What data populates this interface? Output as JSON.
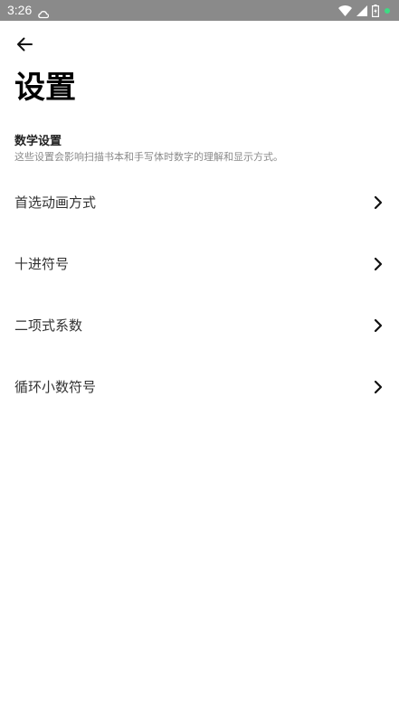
{
  "status_bar": {
    "time": "3:26"
  },
  "header": {
    "title": "设置"
  },
  "section": {
    "title": "数学设置",
    "description": "这些设置会影响扫描书本和手写体时数字的理解和显示方式。"
  },
  "settings": [
    {
      "label": "首选动画方式"
    },
    {
      "label": "十进符号"
    },
    {
      "label": "二项式系数"
    },
    {
      "label": "循环小数符号"
    }
  ],
  "colors": {
    "status_bar_bg": "#8a8a8a",
    "battery_dot": "#3ddc84"
  }
}
